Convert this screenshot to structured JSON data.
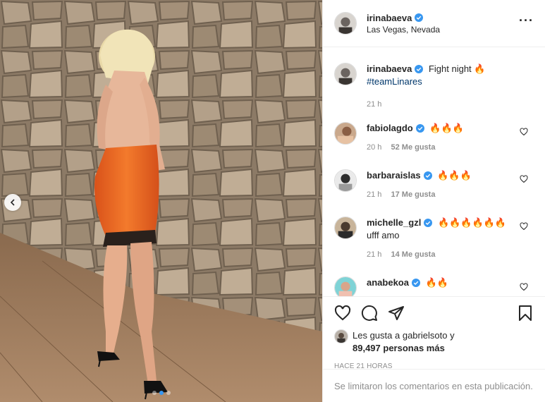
{
  "post": {
    "author": "irinabaeva",
    "location": "Las Vegas, Nevada",
    "more_icon": "more-horizontal-icon",
    "caption": {
      "username": "irinabaeva",
      "text": "Fight night",
      "emoji": "🔥",
      "hashtag": "#teamLinares",
      "time": "21 h"
    },
    "carousel": {
      "total_slides": 3,
      "active_index": 2
    }
  },
  "comments": [
    {
      "username": "fabiolagdo",
      "text": "",
      "emoji": "🔥🔥🔥",
      "time": "20 h",
      "likes": "52 Me gusta"
    },
    {
      "username": "barbaraislas",
      "text": "",
      "emoji": "🔥🔥🔥",
      "time": "21 h",
      "likes": "17 Me gusta"
    },
    {
      "username": "michelle_gzl",
      "text": "ufff amo",
      "emoji": "🔥🔥🔥🔥🔥🔥",
      "time": "21 h",
      "likes": "14 Me gusta"
    },
    {
      "username": "anabekoa",
      "text": "",
      "emoji": "🔥🔥",
      "time": "",
      "likes": ""
    }
  ],
  "actions": {
    "like_icon": "heart-icon",
    "comment_icon": "comment-icon",
    "share_icon": "send-icon",
    "save_icon": "bookmark-icon"
  },
  "likes": {
    "prefix": "Les gusta a",
    "user": "gabrielsoto",
    "suffix": "y",
    "count": "89,497 personas más"
  },
  "timestamp": "HACE 21 HORAS",
  "comments_disabled": "Se limitaron los comentarios en esta publicación.",
  "colors": {
    "verified": "#3897f0",
    "dress": "#e8621f",
    "text": "#262626",
    "muted": "#8e8e8e"
  }
}
